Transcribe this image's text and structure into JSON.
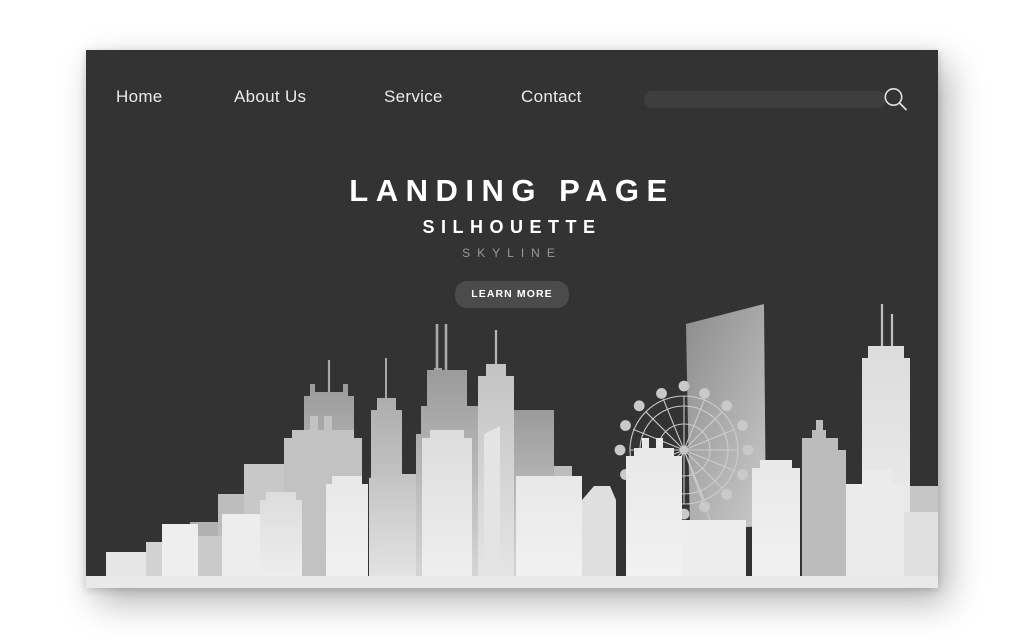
{
  "page": {
    "background_color": "#ffffff",
    "card_background": "#333333"
  },
  "nav": {
    "items": [
      {
        "label": "Home"
      },
      {
        "label": "About  Us"
      },
      {
        "label": "Service"
      },
      {
        "label": "Contact"
      }
    ],
    "search": {
      "value": "",
      "placeholder": "",
      "icon": "search-icon"
    }
  },
  "hero": {
    "title": "LANDING PAGE",
    "subtitle": "SILHOUETTE",
    "tagline": "SKYLINE",
    "cta_label": "LEARN MORE",
    "title_color": "#ffffff",
    "tagline_color": "#9a9a9a",
    "cta_background": "#4b4b4b"
  },
  "illustration": {
    "name": "city-skyline-silhouette",
    "features": [
      "ferris-wheel",
      "skyscrapers",
      "antenna-towers",
      "ground-strip"
    ],
    "palette": {
      "far_layer_dark": "#8c8c8c",
      "mid_layer": "#b4b4b4",
      "near_layer_light": "#e3e3e3",
      "front_layer": "#ececec",
      "ground": "#e8e8e8"
    }
  }
}
